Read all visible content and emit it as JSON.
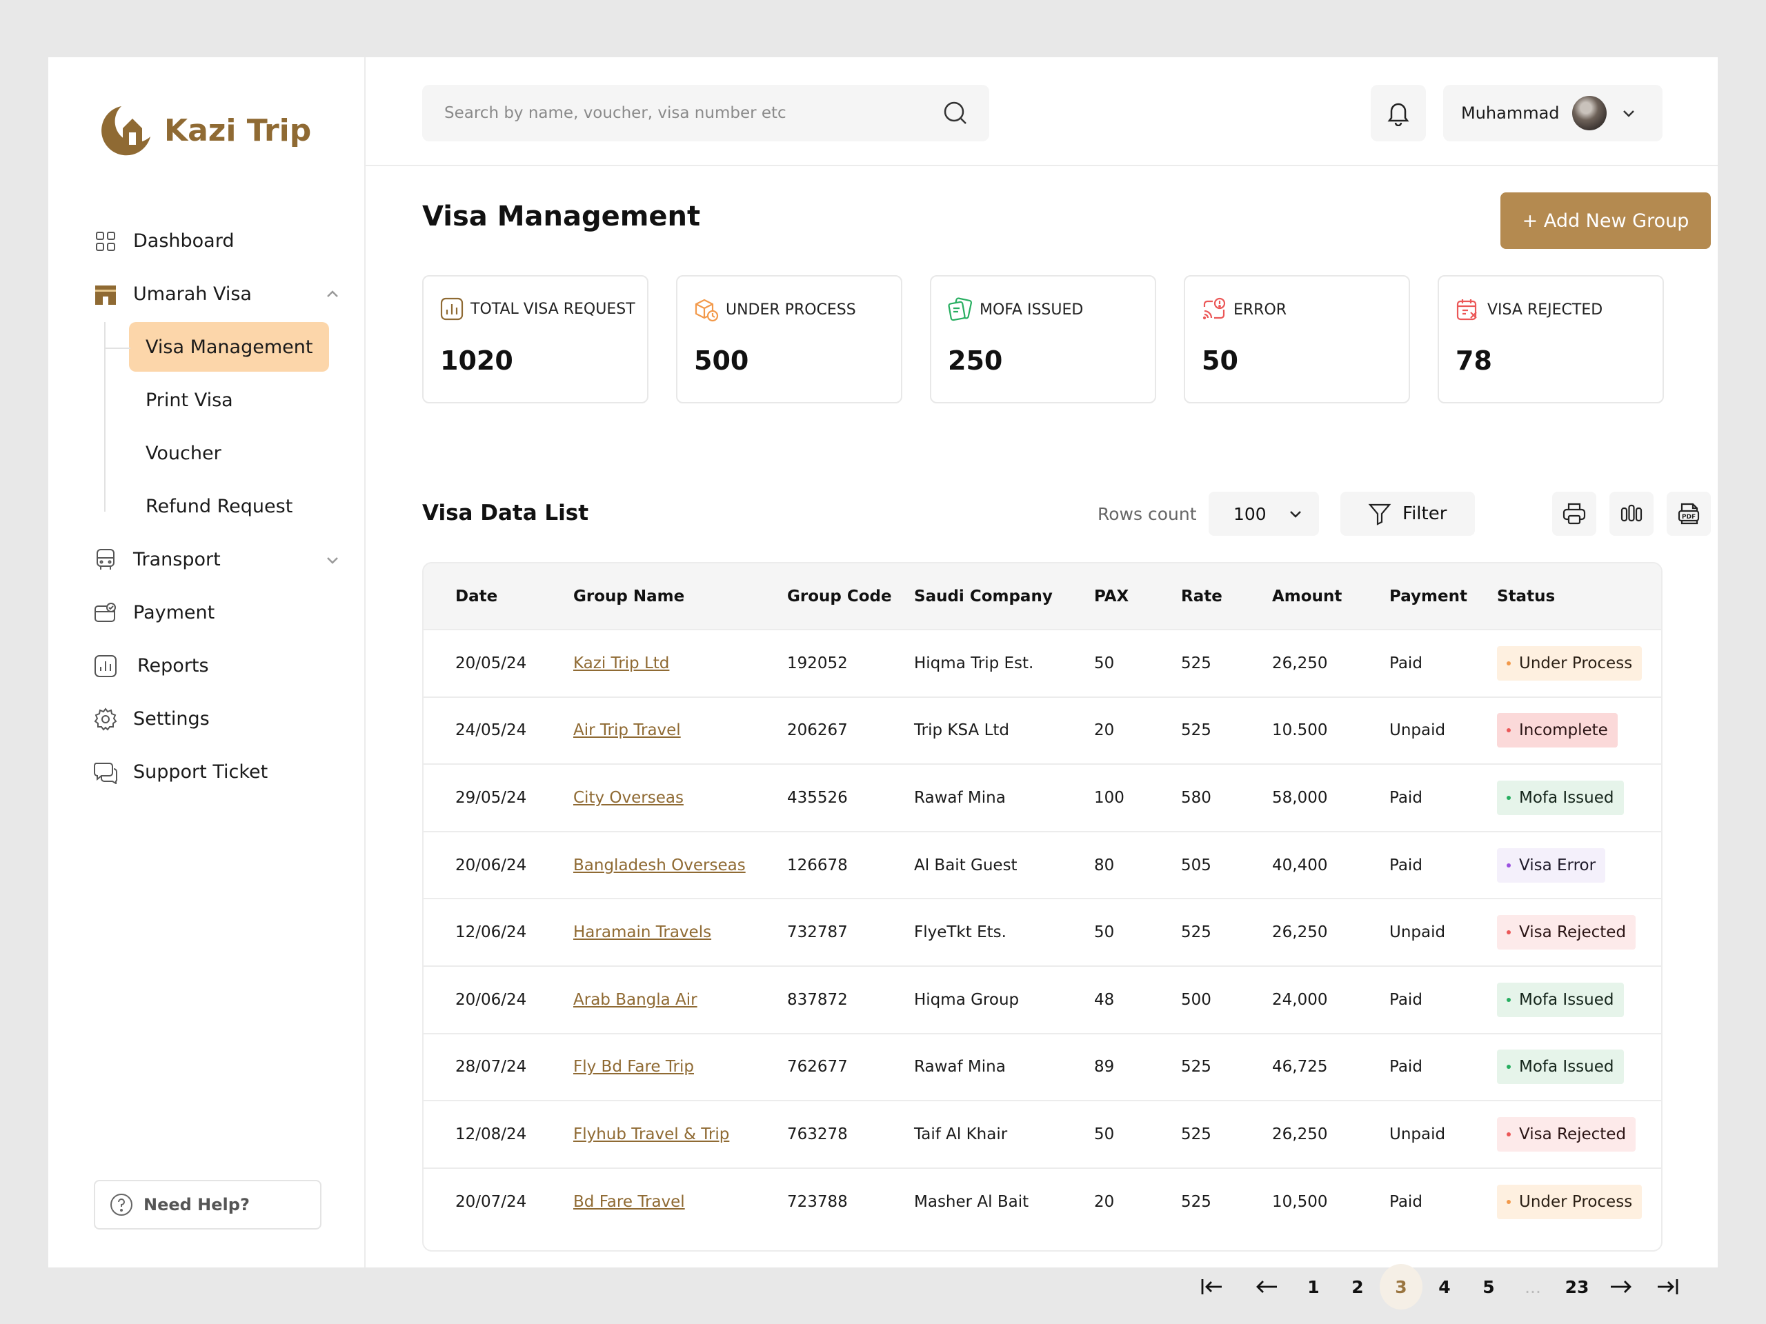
{
  "brand": {
    "name": "Kazi Trip",
    "color": "#8f6a33"
  },
  "sidebar": {
    "items": [
      {
        "label": "Dashboard",
        "icon": "grid-icon"
      },
      {
        "label": "Umarah Visa",
        "icon": "kaaba-icon",
        "expanded": true,
        "children": [
          {
            "label": "Visa Management",
            "active": true
          },
          {
            "label": "Print Visa"
          },
          {
            "label": "Voucher"
          },
          {
            "label": "Refund Request"
          }
        ]
      },
      {
        "label": "Transport",
        "icon": "bus-icon"
      },
      {
        "label": "Payment",
        "icon": "card-icon"
      },
      {
        "label": "Reports",
        "icon": "chart-icon"
      },
      {
        "label": "Settings",
        "icon": "gear-icon"
      },
      {
        "label": "Support Ticket",
        "icon": "chat-icon"
      }
    ],
    "help_label": "Need Help?"
  },
  "header": {
    "search_placeholder": "Search by name, voucher, visa number etc",
    "user_name": "Muhammad"
  },
  "page": {
    "title": "Visa Management",
    "add_button": "+ Add New Group"
  },
  "stats": [
    {
      "label": "TOTAL VISA REQUEST",
      "value": "1020",
      "icon": "bar-chart-icon",
      "color": "#8f6a33"
    },
    {
      "label": "UNDER PROCESS",
      "value": "500",
      "icon": "box-clock-icon",
      "color": "#f2994a"
    },
    {
      "label": "MOFA ISSUED",
      "value": "250",
      "icon": "cards-icon",
      "color": "#27ae60"
    },
    {
      "label": "ERROR",
      "value": "50",
      "icon": "cast-alert-icon",
      "color": "#eb5757"
    },
    {
      "label": "VISA REJECTED",
      "value": "78",
      "icon": "calendar-x-icon",
      "color": "#eb5757"
    }
  ],
  "list": {
    "title": "Visa Data List",
    "rows_label": "Rows count",
    "rows_value": "100",
    "filter_label": "Filter"
  },
  "table": {
    "columns": [
      "Date",
      "Group Name",
      "Group Code",
      "Saudi Company",
      "PAX",
      "Rate",
      "Amount",
      "Payment",
      "Status"
    ],
    "rows": [
      {
        "date": "20/05/24",
        "group": "Kazi Trip Ltd",
        "code": "192052",
        "company": "Hiqma Trip Est.",
        "pax": "50",
        "rate": "525",
        "amount": "26,250",
        "payment": "Paid",
        "status": "Under Process",
        "status_kind": "under"
      },
      {
        "date": "24/05/24",
        "group": "Air Trip Travel",
        "code": "206267",
        "company": "Trip KSA Ltd",
        "pax": "20",
        "rate": "525",
        "amount": "10.500",
        "payment": "Unpaid",
        "status": "Incomplete",
        "status_kind": "incomplete"
      },
      {
        "date": "29/05/24",
        "group": "City Overseas",
        "code": "435526",
        "company": "Rawaf Mina",
        "pax": "100",
        "rate": "580",
        "amount": "58,000",
        "payment": "Paid",
        "status": "Mofa Issued",
        "status_kind": "mofa"
      },
      {
        "date": "20/06/24",
        "group": "Bangladesh Overseas",
        "code": "126678",
        "company": "Al Bait Guest",
        "pax": "80",
        "rate": "505",
        "amount": "40,400",
        "payment": "Paid",
        "status": "Visa Error",
        "status_kind": "error"
      },
      {
        "date": "12/06/24",
        "group": "Haramain Travels",
        "code": "732787",
        "company": "FlyeTkt Ets.",
        "pax": "50",
        "rate": "525",
        "amount": "26,250",
        "payment": "Unpaid",
        "status": "Visa Rejected",
        "status_kind": "rejected"
      },
      {
        "date": "20/06/24",
        "group": "Arab Bangla Air",
        "code": "837872",
        "company": "Hiqma Group",
        "pax": "48",
        "rate": "500",
        "amount": "24,000",
        "payment": "Paid",
        "status": "Mofa Issued",
        "status_kind": "mofa"
      },
      {
        "date": "28/07/24",
        "group": "Fly Bd Fare Trip",
        "code": "762677",
        "company": "Rawaf Mina",
        "pax": "89",
        "rate": "525",
        "amount": "46,725",
        "payment": "Paid",
        "status": "Mofa Issued",
        "status_kind": "mofa"
      },
      {
        "date": "12/08/24",
        "group": "Flyhub Travel & Trip",
        "code": "763278",
        "company": "Taif Al Khair",
        "pax": "50",
        "rate": "525",
        "amount": "26,250",
        "payment": "Unpaid",
        "status": "Visa Rejected",
        "status_kind": "rejected"
      },
      {
        "date": "20/07/24",
        "group": "Bd Fare Travel",
        "code": "723788",
        "company": "Masher Al Bait",
        "pax": "20",
        "rate": "525",
        "amount": "10,500",
        "payment": "Paid",
        "status": "Under Process",
        "status_kind": "under"
      }
    ]
  },
  "pagination": {
    "pages": [
      "1",
      "2",
      "3",
      "4",
      "5",
      "...",
      "23"
    ],
    "current": "3"
  }
}
